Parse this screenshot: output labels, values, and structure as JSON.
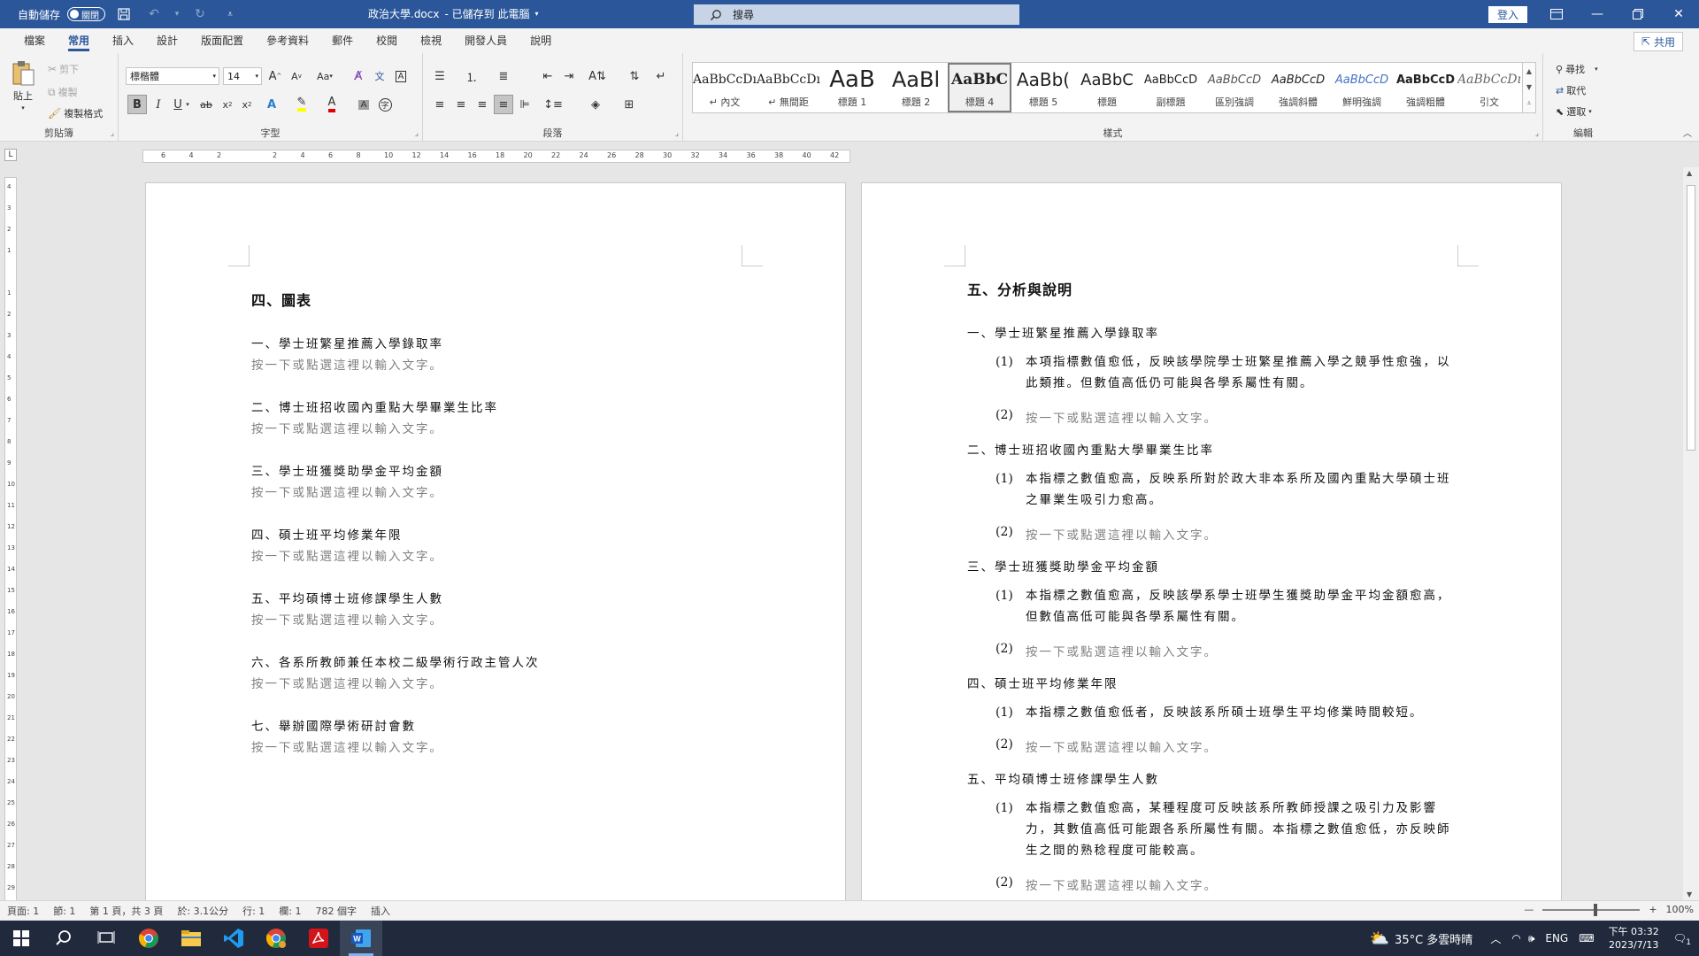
{
  "titlebar": {
    "autosave_label": "自動儲存",
    "autosave_state": "關閉",
    "doc_name": "政治大學.docx",
    "save_status": "- 已儲存到 此電腦",
    "search_placeholder": "搜尋",
    "signin": "登入"
  },
  "tabs": [
    "檔案",
    "常用",
    "插入",
    "設計",
    "版面配置",
    "參考資料",
    "郵件",
    "校閱",
    "檢視",
    "開發人員",
    "說明"
  ],
  "active_tab": "常用",
  "share_label": "共用",
  "ribbon": {
    "clipboard": {
      "paste": "貼上",
      "cut": "剪下",
      "copy": "複製",
      "format_painter": "複製格式",
      "label": "剪貼簿"
    },
    "font": {
      "name": "標楷體",
      "size": "14",
      "label": "字型",
      "change_case": "Aa"
    },
    "paragraph": {
      "label": "段落"
    },
    "styles": {
      "label": "樣式",
      "items": [
        {
          "sample": "AaBbCcDı",
          "name": "↵ 內文"
        },
        {
          "sample": "AaBbCcDı",
          "name": "↵ 無間距"
        },
        {
          "sample": "AaB",
          "name": "標題 1"
        },
        {
          "sample": "AaBl",
          "name": "標題 2"
        },
        {
          "sample": "AaBbC",
          "name": "標題 4"
        },
        {
          "sample": "AaBb(",
          "name": "標題 5"
        },
        {
          "sample": "AaBbC",
          "name": "標題"
        },
        {
          "sample": "AaBbCcD",
          "name": "副標題"
        },
        {
          "sample": "AaBbCcD",
          "name": "區別強調"
        },
        {
          "sample": "AaBbCcD",
          "name": "強調斜體"
        },
        {
          "sample": "AaBbCcD",
          "name": "鮮明強調"
        },
        {
          "sample": "AaBbCcD",
          "name": "強調粗體"
        },
        {
          "sample": "AaBbCcDı",
          "name": "引文"
        }
      ]
    },
    "editing": {
      "find": "尋找",
      "replace": "取代",
      "select": "選取",
      "label": "編輯"
    }
  },
  "ruler": {
    "horizontal": [
      "6",
      "4",
      "2",
      "",
      "2",
      "4",
      "6",
      "8",
      "10",
      "12",
      "14",
      "16",
      "18",
      "20",
      "22",
      "24",
      "26",
      "28",
      "30",
      "32",
      "34",
      "36",
      "38",
      "40",
      "42"
    ],
    "vertical": [
      "4",
      "3",
      "2",
      "1",
      "",
      "1",
      "2",
      "3",
      "4",
      "5",
      "6",
      "7",
      "8",
      "9",
      "10",
      "11",
      "12",
      "13",
      "14",
      "15",
      "16",
      "17",
      "18",
      "19",
      "20",
      "21",
      "22",
      "23",
      "24",
      "25",
      "26",
      "27",
      "28",
      "29"
    ],
    "corner": "L"
  },
  "page1": {
    "heading": "四、圖表",
    "placeholder": "按一下或點選這裡以輸入文字。",
    "items": [
      "一、學士班繁星推薦入學錄取率",
      "二、博士班招收國內重點大學畢業生比率",
      "三、學士班獲獎助學金平均金額",
      "四、碩士班平均修業年限",
      "五、平均碩博士班修課學生人數",
      "六、各系所教師兼任本校二級學術行政主管人次",
      "七、舉辦國際學術研討會數"
    ]
  },
  "page2": {
    "heading": "五、分析與說明",
    "placeholder": "按一下或點選這裡以輸入文字。",
    "sections": [
      {
        "title": "一、學士班繁星推薦入學錄取率",
        "p1_num": "(1)",
        "p1_lines": [
          "本項指標數值愈低，反映該學院學士班繁星推薦入學之競爭性愈強，以",
          "此類推。但數值高低仍可能與各學系屬性有關。"
        ],
        "p2_num": "(2)"
      },
      {
        "title": "二、博士班招收國內重點大學畢業生比率",
        "p1_num": "(1)",
        "p1_lines": [
          "本指標之數值愈高，反映系所對於政大非本系所及國內重點大學碩士班",
          "之畢業生吸引力愈高。"
        ],
        "p2_num": "(2)"
      },
      {
        "title": "三、學士班獲獎助學金平均金額",
        "p1_num": "(1)",
        "p1_lines": [
          "本指標之數值愈高，反映該學系學士班學生獲獎助學金平均金額愈高，",
          "但數值高低可能與各學系屬性有關。"
        ],
        "p2_num": "(2)"
      },
      {
        "title": "四、碩士班平均修業年限",
        "p1_num": "(1)",
        "p1_lines": [
          "本指標之數值愈低者，反映該系所碩士班學生平均修業時間較短。"
        ],
        "p2_num": "(2)"
      },
      {
        "title": "五、平均碩博士班修課學生人數",
        "p1_num": "(1)",
        "p1_lines": [
          "本指標之數值愈高，某種程度可反映該系所教師授課之吸引力及影響",
          "力，其數值高低可能跟各系所屬性有關。本指標之數值愈低，亦反映師",
          "生之間的熟稔程度可能較高。"
        ],
        "p2_num": "(2)"
      }
    ]
  },
  "statusbar": {
    "page": "頁面: 1",
    "section": "節: 1",
    "page_of": "第 1 頁，共 3 頁",
    "at": "於: 3.1公分",
    "line": "行: 1",
    "column": "欄: 1",
    "words": "782 個字",
    "mode": "插入",
    "zoom": "100%"
  },
  "taskbar": {
    "weather": "35°C 多雲時晴",
    "lang": "ENG",
    "time": "下午 03:32",
    "date": "2023/7/13",
    "notif_count": "1"
  },
  "colors": {
    "word_blue": "#2b579a",
    "taskbar": "#202a3c",
    "placeholder_gray": "#808080"
  }
}
